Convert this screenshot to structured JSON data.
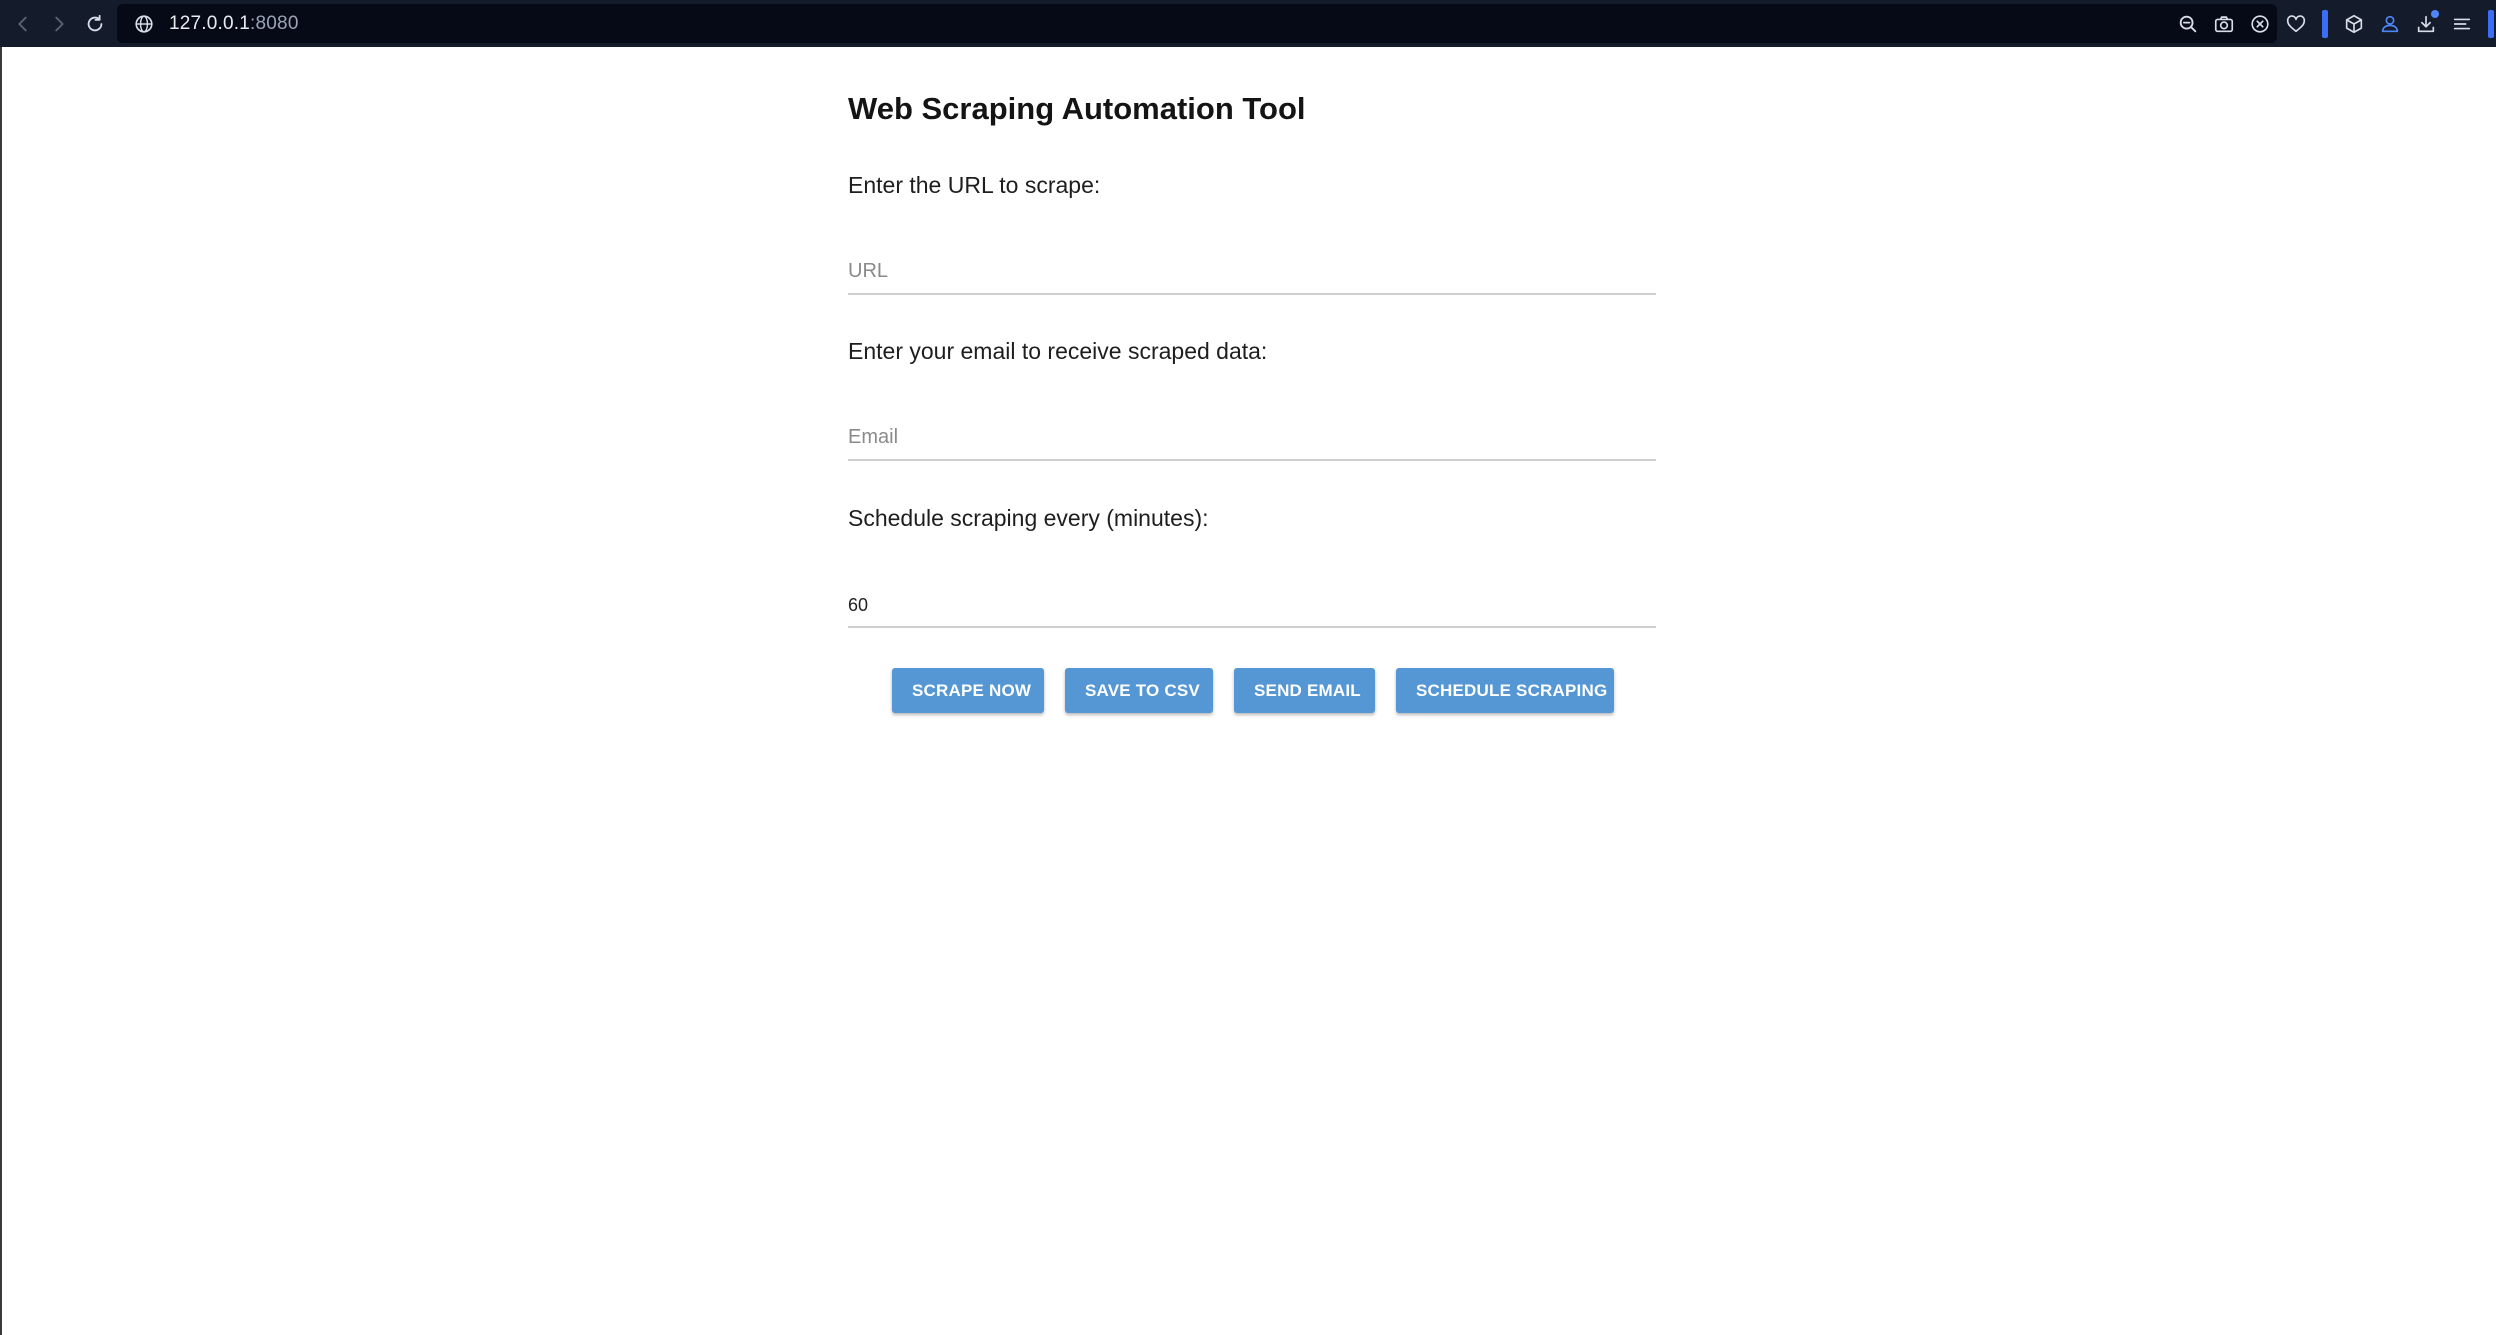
{
  "browser": {
    "url_host": "127.0.0.1",
    "url_port": ":8080",
    "accent_color": "#3d6df2",
    "chrome_color": "#141b2b",
    "icons": [
      "back-icon",
      "forward-icon",
      "reload-icon",
      "globe-icon",
      "zoom-out-icon",
      "camera-icon",
      "blocker-icon",
      "heart-icon",
      "cube-icon",
      "account-icon",
      "download-icon",
      "menu-icon"
    ]
  },
  "app": {
    "title": "Web Scraping Automation Tool",
    "url_label": "Enter the URL to scrape:",
    "url_placeholder": "URL",
    "url_value": "",
    "email_label": "Enter your email to receive scraped data:",
    "email_placeholder": "Email",
    "email_value": "",
    "schedule_label": "Schedule scraping every (minutes):",
    "schedule_value": "60",
    "button_color": "#5497d4",
    "buttons": {
      "scrape_now": "SCRAPE NOW",
      "save_csv": "SAVE TO CSV",
      "send_email": "SEND EMAIL",
      "schedule": "SCHEDULE SCRAPING"
    }
  }
}
